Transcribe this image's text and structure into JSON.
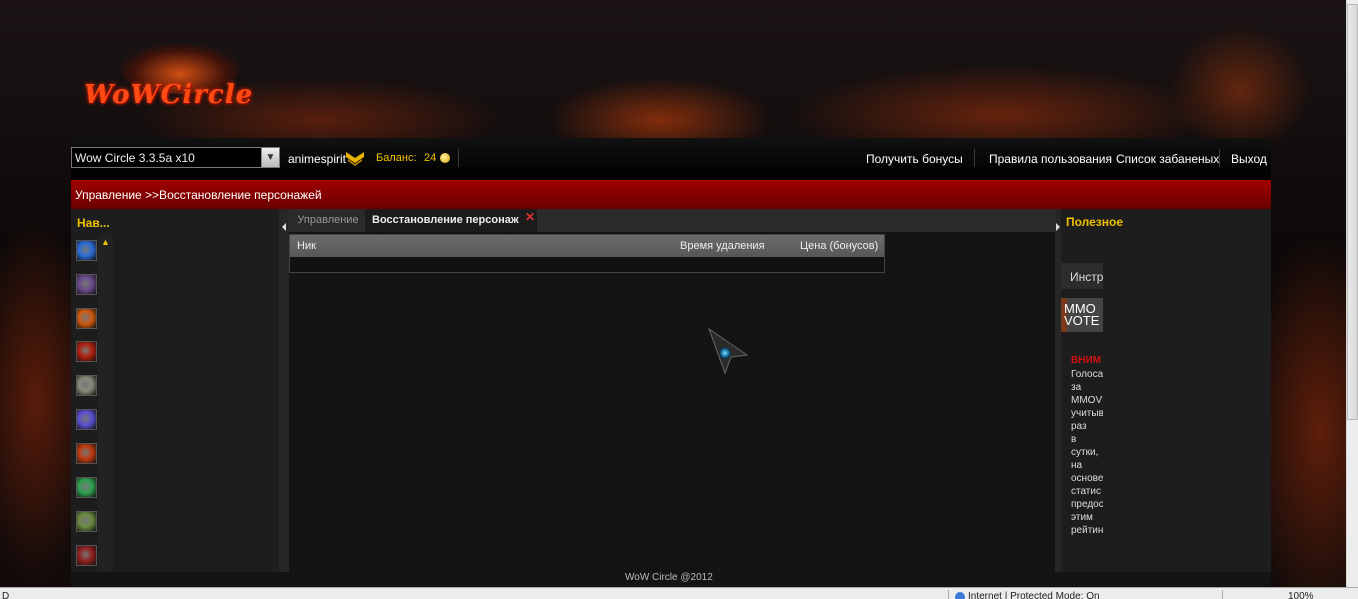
{
  "logo": {
    "text": "WoWCircle"
  },
  "topbar": {
    "realm": "Wow Circle 3.3.5a x10",
    "username": "animespirit",
    "balance_label": "Баланс:",
    "balance_value": "24",
    "links": [
      "Получить бонусы",
      "Правила пользования",
      "Список забаненых",
      "Выход"
    ]
  },
  "breadcrumb": "Управление >>Восстановление персонажей",
  "leftnav": {
    "title": "Нав..."
  },
  "nav_icon_colors": [
    "#2a6cd8",
    "#6a4a8a",
    "#d05a10",
    "#b02010",
    "#8a8a7a",
    "#5a50d0",
    "#c03a10",
    "#30a050",
    "#6a8a40",
    "#902020"
  ],
  "tabs": [
    {
      "label": "Управление"
    },
    {
      "label": "Восстановление персонаж"
    }
  ],
  "table": {
    "columns": [
      "Ник",
      "Время удаления",
      "Цена (бонусов)"
    ]
  },
  "rightpanel": {
    "title": "Полезное",
    "tab_label": "Инстр",
    "banner_line1": "MMO",
    "banner_line2": "VOTE",
    "notice_head": "ВНИМ",
    "notice_lines": [
      "Голоса",
      "за",
      "MMOV",
      "учитыв",
      "раз",
      "в",
      "сутки,",
      "на",
      "основе",
      "статис",
      "предос",
      "этим",
      "рейтин"
    ]
  },
  "footer": "WoW Circle @2012",
  "statusbar": {
    "left": "D",
    "zone": "Internet | Protected Mode: On",
    "zoom": "100%"
  },
  "colors": {
    "accent_yellow": "#f0c000",
    "bar_red": "#a00000",
    "close_red": "#e03030"
  }
}
